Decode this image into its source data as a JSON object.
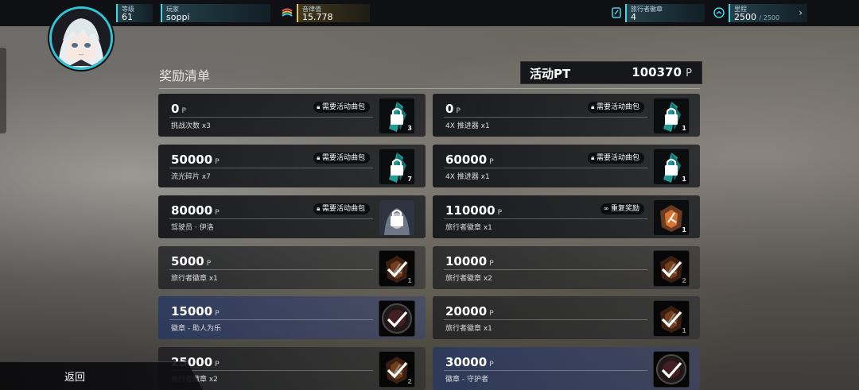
{
  "topbar": {
    "level": {
      "label": "等级",
      "value": "61"
    },
    "player": {
      "label": "玩家",
      "value": "soppi"
    },
    "rhythm": {
      "label": "音律值",
      "value": "15.778"
    },
    "traveler_badge": {
      "label": "旅行者徽章",
      "value": "4"
    },
    "mileage": {
      "label": "里程",
      "value": "2500",
      "max": "/ 2500"
    }
  },
  "header": {
    "title": "奖励清单",
    "pt_label": "活动PT",
    "pt_value": "100370",
    "pt_unit": "P"
  },
  "rewards": [
    {
      "points": "0",
      "unit": "P",
      "desc": "挑战次数 x3",
      "badge": "需要活动曲包",
      "qty": "3",
      "state": "locked",
      "icon": "crystal-icon"
    },
    {
      "points": "0",
      "unit": "P",
      "desc": "4X 推进器 x1",
      "badge": "需要活动曲包",
      "qty": "1",
      "state": "locked",
      "icon": "booster-icon"
    },
    {
      "points": "50000",
      "unit": "P",
      "desc": "流光碎片 x7",
      "badge": "需要活动曲包",
      "qty": "7",
      "state": "locked",
      "icon": "shard-icon"
    },
    {
      "points": "60000",
      "unit": "P",
      "desc": "4X 推进器 x1",
      "badge": "需要活动曲包",
      "qty": "1",
      "state": "locked",
      "icon": "booster-icon"
    },
    {
      "points": "80000",
      "unit": "P",
      "desc": "驾驶员 · 伊洛",
      "badge": "需要活动曲包",
      "qty": "",
      "state": "locked",
      "icon": "pilot-portrait-icon"
    },
    {
      "points": "110000",
      "unit": "P",
      "desc": "旅行者徽章 x1",
      "badge": "重复奖励",
      "qty": "1",
      "state": "repeat",
      "icon": "traveler-badge-icon"
    },
    {
      "points": "5000",
      "unit": "P",
      "desc": "旅行者徽章 x1",
      "badge": "",
      "qty": "1",
      "state": "claimed",
      "icon": "traveler-badge-icon"
    },
    {
      "points": "10000",
      "unit": "P",
      "desc": "旅行者徽章 x2",
      "badge": "",
      "qty": "2",
      "state": "claimed",
      "icon": "traveler-badge-icon"
    },
    {
      "points": "15000",
      "unit": "P",
      "desc": "徽章 - 助人为乐",
      "badge": "",
      "qty": "",
      "state": "claimed",
      "icon": "medal-icon"
    },
    {
      "points": "20000",
      "unit": "P",
      "desc": "旅行者徽章 x1",
      "badge": "",
      "qty": "1",
      "state": "claimed",
      "icon": "traveler-badge-icon"
    },
    {
      "points": "25000",
      "unit": "P",
      "desc": "旅行者徽章 x2",
      "badge": "",
      "qty": "2",
      "state": "claimed",
      "icon": "traveler-badge-icon"
    },
    {
      "points": "30000",
      "unit": "P",
      "desc": "徽章 - 守护者",
      "badge": "",
      "qty": "",
      "state": "claimed",
      "icon": "medal-icon"
    }
  ],
  "footer": {
    "back_label": "返回"
  },
  "colors": {
    "accent": "#3fd8e6",
    "gold": "#e8c24a",
    "card_dark": "#16181c",
    "card_blue": "#37497f"
  }
}
